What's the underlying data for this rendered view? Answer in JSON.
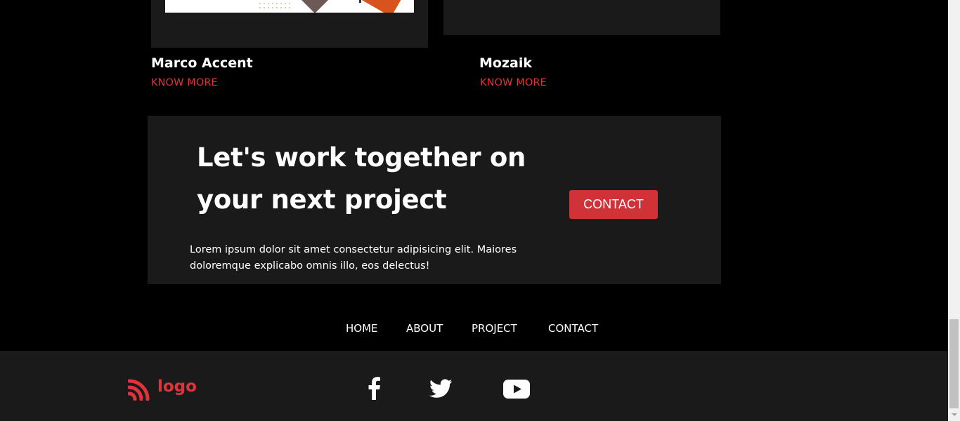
{
  "projects": [
    {
      "title": "Marco Accent",
      "link_label": "KNOW MORE"
    },
    {
      "title": "Mozaik",
      "link_label": "KNOW MORE"
    }
  ],
  "cta": {
    "heading": "Let's work together on your next project",
    "body": "Lorem ipsum dolor sit amet consectetur adipisicing elit. Maiores doloremque explicabo omnis illo, eos delectus!",
    "button_label": "CONTACT"
  },
  "nav": {
    "items": [
      "HOME",
      "ABOUT",
      "PROJECT",
      "CONTACT"
    ]
  },
  "footer": {
    "logo_text": "logo",
    "social": [
      {
        "icon": "facebook-icon"
      },
      {
        "icon": "twitter-icon"
      },
      {
        "icon": "youtube-icon"
      }
    ]
  },
  "colors": {
    "background": "#000000",
    "panel": "#1a1a1a",
    "accent": "#e0343c",
    "button": "#d03238",
    "text": "#ffffff"
  }
}
